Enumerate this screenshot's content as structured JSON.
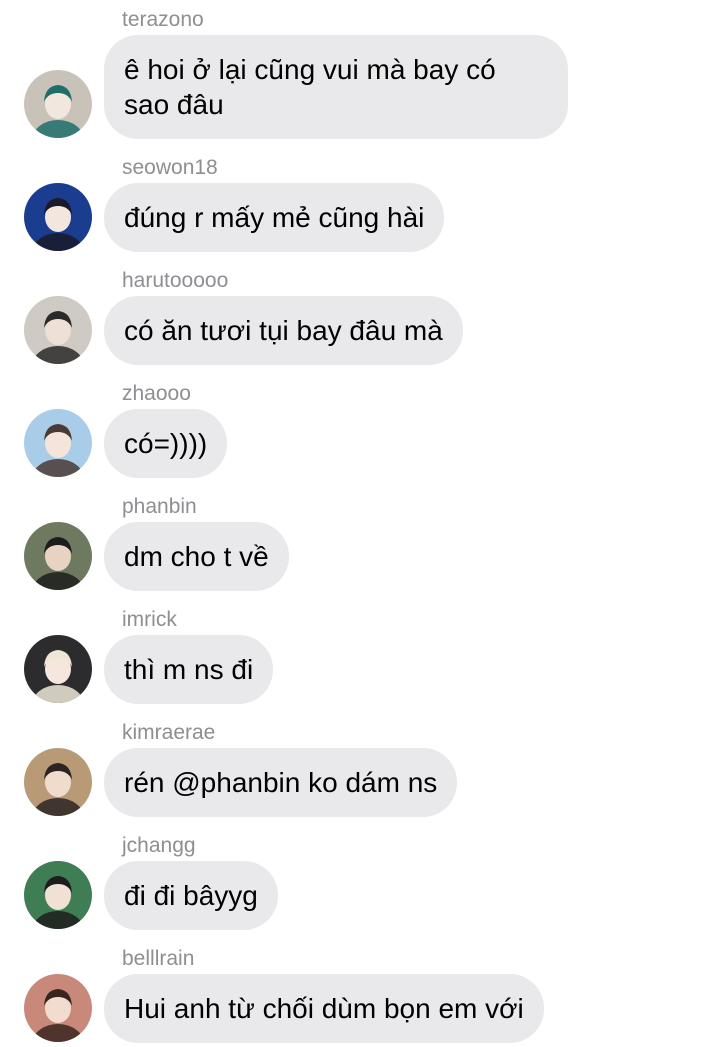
{
  "messages": [
    {
      "sender": "terazono",
      "text": "ê hoi ở lại cũng vui mà bay có sao đâu",
      "avatar_icon": "user-avatar-icon",
      "avatar_colors": [
        "#c9c2b8",
        "#1f6e6a",
        "#f1e7df"
      ]
    },
    {
      "sender": "seowon18",
      "text": "đúng r mấy mẻ cũng hài",
      "avatar_icon": "user-avatar-icon",
      "avatar_colors": [
        "#1b3d8f",
        "#1a1a2a",
        "#f3e6de"
      ]
    },
    {
      "sender": "harutooooo",
      "text": "có ăn tươi tụi bay đâu mà",
      "avatar_icon": "user-avatar-icon",
      "avatar_colors": [
        "#cfcac4",
        "#2a2a2a",
        "#efe0d6"
      ]
    },
    {
      "sender": "zhaooo",
      "text": "có=))))",
      "avatar_icon": "user-avatar-icon",
      "avatar_colors": [
        "#a9cde8",
        "#4a3a35",
        "#f4e4da"
      ]
    },
    {
      "sender": "phanbin",
      "text": "dm cho t về",
      "avatar_icon": "user-avatar-icon",
      "avatar_colors": [
        "#6e7a60",
        "#1d1d1d",
        "#e8d2c2"
      ]
    },
    {
      "sender": "imrick",
      "text": "thì m ns đi",
      "avatar_icon": "user-avatar-icon",
      "avatar_colors": [
        "#2c2c2e",
        "#efe7d6",
        "#f5e7de"
      ]
    },
    {
      "sender": "kimraerae",
      "text": "rén @phanbin ko dám ns",
      "avatar_icon": "user-avatar-icon",
      "avatar_colors": [
        "#b99a77",
        "#2a2422",
        "#f0dccd"
      ]
    },
    {
      "sender": "jchangg",
      "text": "đi đi bâyyg",
      "avatar_icon": "user-avatar-icon",
      "avatar_colors": [
        "#3f7d54",
        "#1d1d1d",
        "#f1e0d4"
      ]
    },
    {
      "sender": "belllrain",
      "text": "Hui anh từ chối dùm bọn em với",
      "avatar_icon": "user-avatar-icon",
      "avatar_colors": [
        "#c8897a",
        "#3a2420",
        "#f1dccf"
      ]
    }
  ]
}
